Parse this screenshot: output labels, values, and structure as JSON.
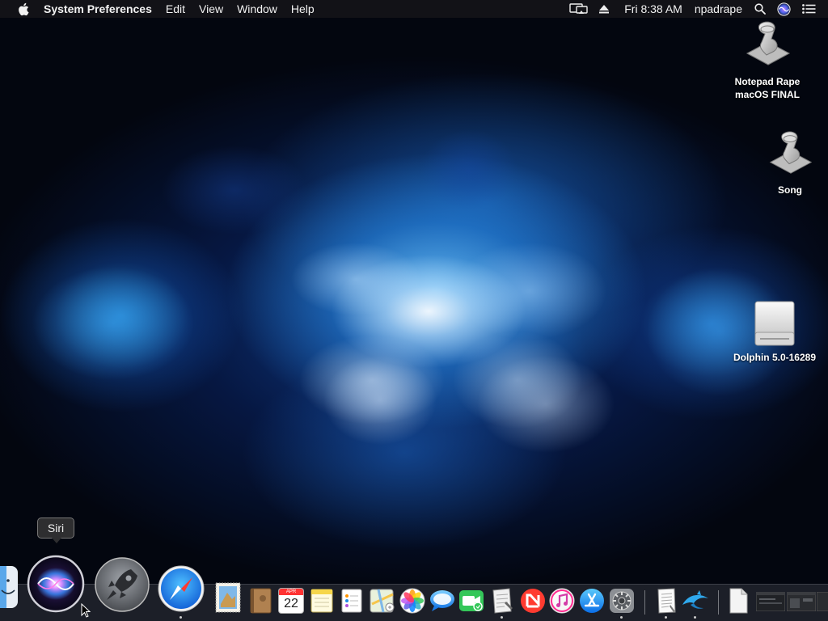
{
  "menubar": {
    "apple_icon": "apple-logo-icon",
    "app_name": "System Preferences",
    "items": [
      {
        "id": "edit",
        "label": "Edit"
      },
      {
        "id": "view",
        "label": "View"
      },
      {
        "id": "window",
        "label": "Window"
      },
      {
        "id": "help",
        "label": "Help"
      }
    ],
    "status": {
      "display_icon": "airplay-display-icon",
      "eject_icon": "eject-icon",
      "clock": "Fri 8:38 AM",
      "user": "npadrape",
      "search_icon": "spotlight-search-icon",
      "siri_icon": "siri-icon",
      "notification_icon": "notification-center-icon"
    }
  },
  "desktop": {
    "icons": [
      {
        "id": "notepad",
        "label": "Notepad Rape\nmacOS FINAL",
        "icon": "script-scroll-icon"
      },
      {
        "id": "song",
        "label": "Song",
        "icon": "script-scroll-icon"
      },
      {
        "id": "dolphin",
        "label": "Dolphin 5.0-16289",
        "icon": "disk-image-icon"
      }
    ]
  },
  "tooltip": {
    "label": "Siri"
  },
  "dock": {
    "apps": [
      "finder",
      "siri",
      "launchpad",
      "safari",
      "mail",
      "contacts",
      "calendar",
      "notes",
      "reminders",
      "maps",
      "photos",
      "messages",
      "facetime",
      "script-editor",
      "news",
      "itunes",
      "app-store",
      "system-preferences",
      "textedit",
      "dolphin",
      "document",
      "minimized-window-1",
      "minimized-window-2"
    ],
    "calendar": {
      "month": "APR",
      "day": "22"
    }
  },
  "colors": {
    "menubar_bg": "#141418",
    "accent_blue": "#1e8ce6",
    "facetime_green": "#34c759",
    "news_red": "#ff3b30"
  }
}
